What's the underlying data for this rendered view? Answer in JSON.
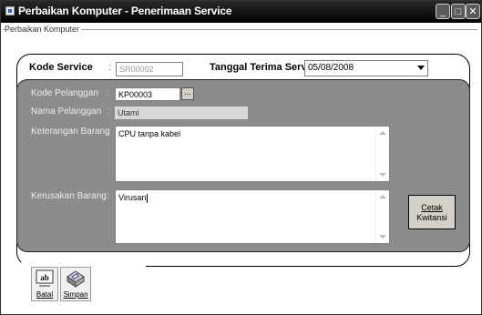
{
  "window": {
    "title": "Perbaikan Komputer - Penerimaan Service",
    "controls": [
      "minimize",
      "maximize",
      "close"
    ]
  },
  "fieldset": {
    "label": "Perbaikan Komputer"
  },
  "form": {
    "kode_service": {
      "label": "Kode Service",
      "colon": ":",
      "value": "SR00002"
    },
    "tanggal": {
      "label": "Tanggal Terima Service :",
      "value": "05/08/2008"
    },
    "kode_pelanggan": {
      "label": "Kode Pelanggan",
      "colon": ":",
      "value": "KP00003",
      "lookup": "..."
    },
    "nama_pelanggan": {
      "label": "Nama Pelanggan",
      "colon": ":",
      "value": "Utami"
    },
    "keterangan": {
      "label": "Keterangan Barang",
      "colon": ":",
      "value": "CPU tanpa kabel"
    },
    "kerusakan": {
      "label": "Kerusakan Barang",
      "colon": ":",
      "value": "Virusan"
    }
  },
  "cetak": {
    "line1": "Cetak",
    "line2": "Kwitansi"
  },
  "toolbar": {
    "batal": {
      "label": "Batal",
      "icon": "ab-text-icon"
    },
    "simpan": {
      "label": "Simpan",
      "icon": "disk-icon"
    }
  }
}
